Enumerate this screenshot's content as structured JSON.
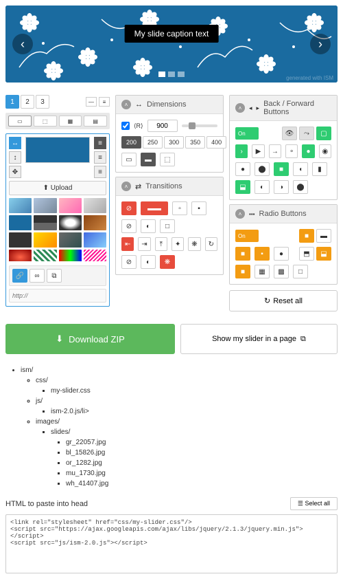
{
  "slider": {
    "caption": "My slide caption text",
    "generated": "generated with ISM"
  },
  "pager": {
    "pages": [
      "1",
      "2",
      "3"
    ]
  },
  "dimensions": {
    "title": "Dimensions",
    "value": "900",
    "widths": [
      "200",
      "250",
      "300",
      "350",
      "400"
    ]
  },
  "transitions": {
    "title": "Transitions"
  },
  "backforward": {
    "title": "Back / Forward Buttons",
    "toggle": "On"
  },
  "radio": {
    "title": "Radio Buttons",
    "toggle": "On",
    "reset": "Reset all"
  },
  "upload": {
    "label": "Upload",
    "url_placeholder": "http://"
  },
  "actions": {
    "download": "Download ZIP",
    "show": "Show my slider in a page"
  },
  "tree": {
    "root": "ism/",
    "css": "css/",
    "cssfile": "my-slider.css",
    "js": "js/",
    "jsfile": "ism-2.0.js/li>",
    "images": "images/",
    "slides": "slides/",
    "files": [
      "gr_22057.jpg",
      "bl_15826.jpg",
      "or_1282.jpg",
      "mu_1730.jpg",
      "wh_41407.jpg"
    ]
  },
  "html": {
    "label": "HTML to paste into head",
    "select": "Select all",
    "code": "<link rel=\"stylesheet\" href=\"css/my-slider.css\"/>\n<script src=\"https://ajax.googleapis.com/ajax/libs/jquery/2.1.3/jquery.min.js\"></script>\n<script src=\"js/ism-2.0.js\"></script>"
  }
}
